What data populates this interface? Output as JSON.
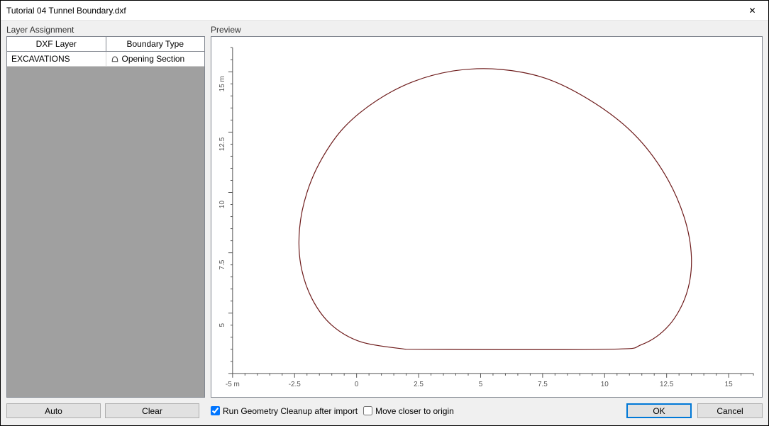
{
  "titlebar": {
    "title": "Tutorial 04 Tunnel Boundary.dxf",
    "close": "✕"
  },
  "left_panel": {
    "label": "Layer Assignment",
    "headers": {
      "layer": "DXF Layer",
      "btype": "Boundary Type"
    },
    "rows": [
      {
        "layer": "EXCAVATIONS",
        "btype": "Opening Section"
      }
    ]
  },
  "right_panel": {
    "label": "Preview"
  },
  "chart_data": {
    "type": "line",
    "title": "",
    "xlabel": "m",
    "ylabel": "m",
    "xlim": [
      -5,
      16
    ],
    "ylim": [
      3,
      16.5
    ],
    "x_ticks": [
      -5,
      -2.5,
      0,
      2.5,
      5,
      7.5,
      10,
      12.5,
      15
    ],
    "x_tick_labels": [
      "-5 m",
      "-2.5",
      "0",
      "2.5",
      "5",
      "7.5",
      "10",
      "12.5",
      "15"
    ],
    "y_ticks": [
      5,
      7.5,
      10,
      12.5,
      15
    ],
    "y_tick_labels": [
      "5",
      "7.5",
      "10",
      "12.5",
      "15 m"
    ],
    "series": [
      {
        "name": "tunnel-boundary",
        "stroke": "#6d1a1a",
        "points": [
          [
            2.0,
            4.0
          ],
          [
            10.0,
            4.0
          ],
          [
            11.5,
            4.2
          ],
          [
            12.6,
            5.0
          ],
          [
            13.3,
            6.3
          ],
          [
            13.5,
            7.8
          ],
          [
            13.2,
            9.5
          ],
          [
            12.4,
            11.3
          ],
          [
            11.2,
            12.9
          ],
          [
            9.6,
            14.2
          ],
          [
            7.7,
            15.2
          ],
          [
            5.8,
            15.6
          ],
          [
            4.0,
            15.55
          ],
          [
            2.3,
            15.1
          ],
          [
            0.8,
            14.3
          ],
          [
            -0.5,
            13.2
          ],
          [
            -1.4,
            11.9
          ],
          [
            -2.0,
            10.5
          ],
          [
            -2.3,
            9.0
          ],
          [
            -2.25,
            7.5
          ],
          [
            -1.8,
            6.1
          ],
          [
            -1.0,
            5.0
          ],
          [
            0.2,
            4.3
          ],
          [
            2.0,
            4.0
          ]
        ]
      }
    ]
  },
  "footer": {
    "auto": "Auto",
    "clear": "Clear",
    "cleanup": "Run Geometry Cleanup after import",
    "cleanup_checked": true,
    "move_origin": "Move closer to origin",
    "move_origin_checked": false,
    "ok": "OK",
    "cancel": "Cancel"
  }
}
